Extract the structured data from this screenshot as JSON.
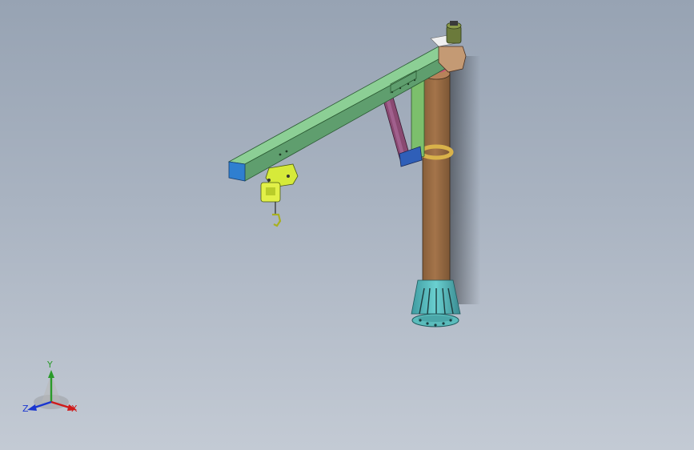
{
  "viewport": {
    "background_top": "#97a3b3",
    "background_bottom": "#c3cad4"
  },
  "model": {
    "name": "jib-crane-assembly",
    "colors": {
      "boom": "#6fae7e",
      "boom_end": "#2f7fd0",
      "column": "#9a6b43",
      "base": "#5bbcbc",
      "hoist": "#d6ea3a",
      "diagonal_brace": "#7a3b63",
      "vertical_brace": "#7cbf6c",
      "motor": "#6b7a3b"
    }
  },
  "triad": {
    "x_label": "X",
    "y_label": "Y",
    "z_label": "Z",
    "x_color": "#d01a1a",
    "y_color": "#2a9a2a",
    "z_color": "#1a36d0"
  }
}
